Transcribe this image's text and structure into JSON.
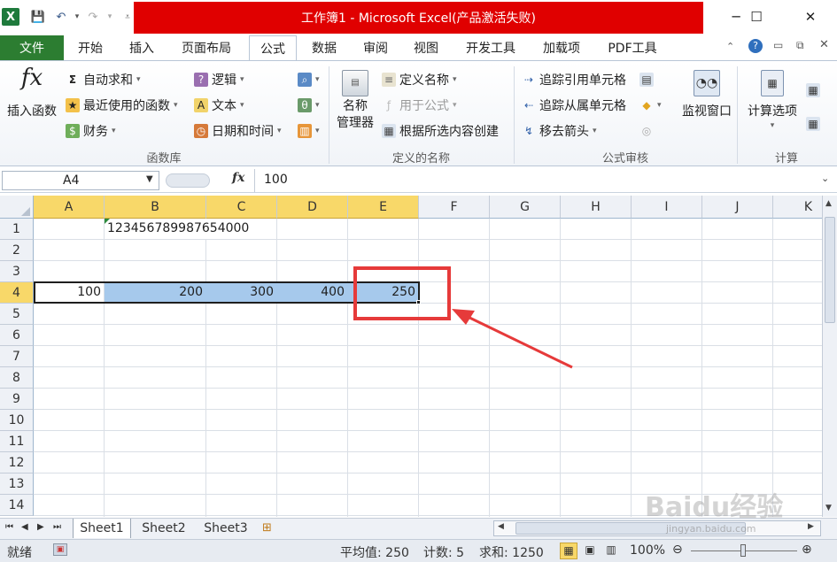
{
  "window": {
    "title": "工作簿1 - Microsoft Excel(产品激活失败)",
    "min_glyph": "─",
    "max_glyph": "☐",
    "close_glyph": "✕"
  },
  "qat": {
    "app_icon": "X",
    "save": "💾",
    "undo": "↶",
    "redo": "↷"
  },
  "tabs": {
    "file": "文件",
    "items": [
      "开始",
      "插入",
      "页面布局",
      "公式",
      "数据",
      "审阅",
      "视图",
      "开发工具",
      "加载项",
      "PDF工具"
    ]
  },
  "ribbon": {
    "function_library": {
      "insert_function": "插入函数",
      "autosum": "自动求和",
      "recent": "最近使用的函数",
      "financial": "财务",
      "logical": "逻辑",
      "text": "文本",
      "datetime": "日期和时间",
      "label": "函数库"
    },
    "defined_names": {
      "name_manager_1": "名称",
      "name_manager_2": "管理器",
      "define_name": "定义名称",
      "use_in_formula": "用于公式",
      "create_from_selection": "根据所选内容创建",
      "label": "定义的名称"
    },
    "formula_auditing": {
      "trace_precedents": "追踪引用单元格",
      "trace_dependents": "追踪从属单元格",
      "remove_arrows": "移去箭头",
      "watch_window": "监视窗口",
      "label": "公式审核"
    },
    "calculation": {
      "calc_options": "计算选项",
      "label": "计算"
    }
  },
  "formula_bar": {
    "name_box": "A4",
    "fx": "fx",
    "value": "100"
  },
  "grid": {
    "columns": [
      "A",
      "B",
      "C",
      "D",
      "E",
      "F",
      "G",
      "H",
      "I",
      "J",
      "K"
    ],
    "rows": [
      "1",
      "2",
      "3",
      "4",
      "5",
      "6",
      "7",
      "8",
      "9",
      "10",
      "11",
      "12",
      "13",
      "14"
    ],
    "b1": "123456789987654000",
    "row4": [
      "100",
      "200",
      "300",
      "400",
      "250"
    ]
  },
  "sheets": [
    "Sheet1",
    "Sheet2",
    "Sheet3"
  ],
  "status": {
    "ready": "就绪",
    "average": "平均值: 250",
    "count": "计数: 5",
    "sum": "求和: 1250",
    "zoom": "100%"
  },
  "watermark": {
    "brand": "Baidu经验",
    "url": "jingyan.baidu.com"
  },
  "colors": {
    "file_tab": "#2c7d31",
    "title_highlight": "#e00000",
    "selection": "#a6c9ec",
    "header_selected": "#f8d869",
    "annotation": "#e63a3a"
  }
}
